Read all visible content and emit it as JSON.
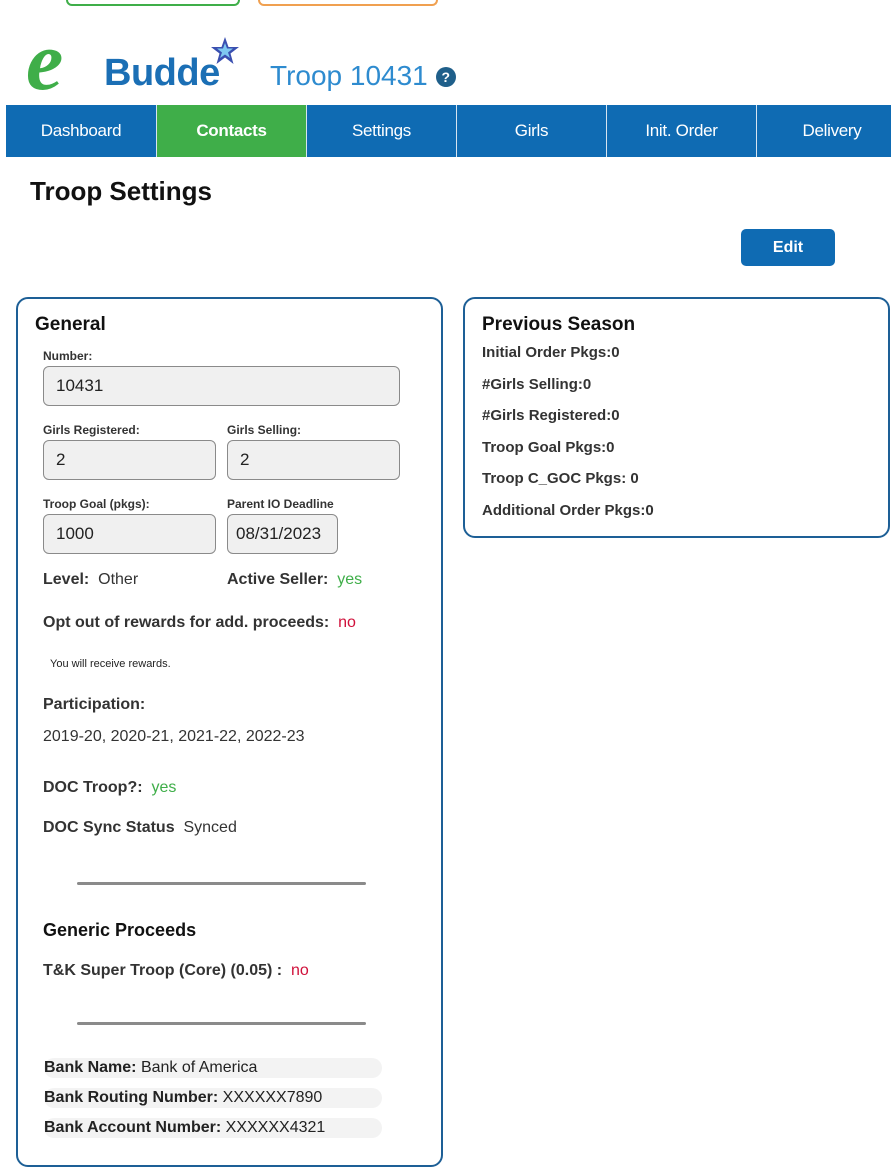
{
  "brand": {
    "logo_letter": "e",
    "logo_word": "Budde",
    "logo_tm": "™"
  },
  "header": {
    "troop_title": "Troop 10431",
    "help_icon": "help-circle-icon"
  },
  "nav": {
    "items": [
      {
        "label": "Dashboard"
      },
      {
        "label": "Contacts"
      },
      {
        "label": "Settings"
      },
      {
        "label": "Girls"
      },
      {
        "label": "Init. Order"
      },
      {
        "label": "Delivery"
      }
    ],
    "active": "Contacts"
  },
  "page": {
    "title": "Troop Settings",
    "edit_label": "Edit"
  },
  "general": {
    "title": "General",
    "number_label": "Number:",
    "number_value": "10431",
    "girls_registered_label": "Girls Registered:",
    "girls_registered_value": "2",
    "girls_selling_label": "Girls Selling:",
    "girls_selling_value": "2",
    "troop_goal_label": "Troop Goal (pkgs):",
    "troop_goal_value": "1000",
    "parent_io_label": "Parent IO Deadline",
    "parent_io_value": "08/31/2023",
    "level_label": "Level:",
    "level_value": "Other",
    "active_seller_label": "Active Seller:",
    "active_seller_value": "yes",
    "opt_out_label": "Opt out of rewards for add. proceeds:",
    "opt_out_value": "no",
    "rewards_note": "You will receive rewards.",
    "participation_label": "Participation:",
    "participation_value": "2019-20, 2020-21, 2021-22, 2022-23",
    "doc_troop_label": "DOC Troop?:",
    "doc_troop_value": "yes",
    "doc_sync_label": "DOC Sync Status",
    "doc_sync_value": "Synced",
    "generic_title": "Generic Proceeds",
    "super_troop_label": "T&K Super Troop (Core) (0.05) :",
    "super_troop_value": "no",
    "bank_name_label": "Bank Name:",
    "bank_name_value": "Bank of America",
    "bank_routing_label": "Bank Routing Number:",
    "bank_routing_value": "XXXXXX7890",
    "bank_account_label": "Bank Account Number:",
    "bank_account_value": "XXXXXX4321"
  },
  "previous": {
    "title": "Previous Season",
    "rows": [
      "Initial Order Pkgs:0",
      "#Girls Selling:0",
      "#Girls Registered:0",
      "Troop Goal Pkgs:0",
      "Troop C_GOC Pkgs: 0",
      "Additional Order Pkgs:0"
    ]
  },
  "colors": {
    "nav_blue": "#0f6bb3",
    "active_green": "#3fae49",
    "no_red": "#d0103a",
    "card_border": "#1d5f96"
  }
}
